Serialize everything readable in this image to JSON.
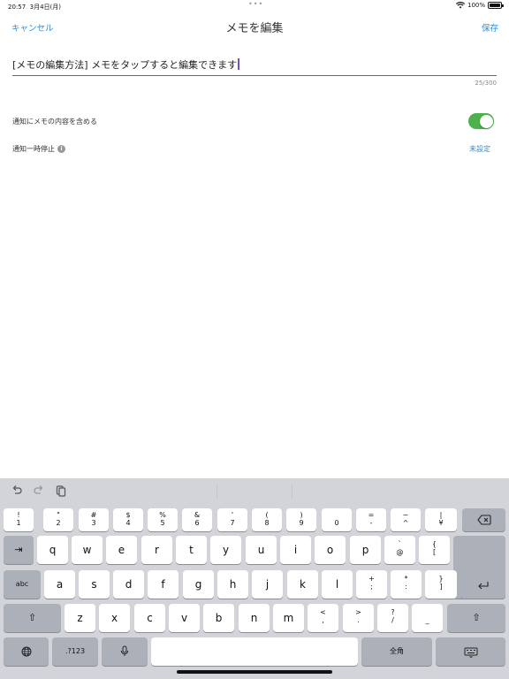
{
  "status_bar": {
    "time": "20:57",
    "date": "3月4日(月)",
    "battery": "100%"
  },
  "nav": {
    "cancel_label": "キャンセル",
    "title": "メモを編集",
    "save_label": "保存"
  },
  "memo": {
    "value": "[メモの編集方法] メモをタップすると編集できます",
    "counter": "25/300"
  },
  "settings": {
    "include_memo_label": "通知にメモの内容を含める",
    "include_memo_on": true,
    "pause_label": "通知一時停止",
    "pause_value": "未設定"
  },
  "colors": {
    "accent": "#2f8bd0",
    "toggle_on": "#4cb24c",
    "focus_line": "#6f53b8",
    "keyboard_bg": "#d2d4da"
  },
  "keyboard": {
    "toolbar_icons": [
      "undo-icon",
      "redo-icon",
      "clipboard-icon"
    ],
    "row1": [
      {
        "top": "!",
        "bot": "1"
      },
      {
        "top": "\"",
        "bot": "2"
      },
      {
        "top": "#",
        "bot": "3"
      },
      {
        "top": "$",
        "bot": "4"
      },
      {
        "top": "%",
        "bot": "5"
      },
      {
        "top": "&",
        "bot": "6"
      },
      {
        "top": "'",
        "bot": "7"
      },
      {
        "top": "(",
        "bot": "8"
      },
      {
        "top": ")",
        "bot": "9"
      },
      {
        "top": "",
        "bot": "0"
      },
      {
        "top": "=",
        "bot": "-"
      },
      {
        "top": "~",
        "bot": "^"
      },
      {
        "top": "|",
        "bot": "¥"
      }
    ],
    "row2": [
      "q",
      "w",
      "e",
      "r",
      "t",
      "y",
      "u",
      "i",
      "o",
      "p"
    ],
    "row2_extra": [
      {
        "top": "`",
        "bot": "@"
      },
      {
        "top": "{",
        "bot": "["
      }
    ],
    "row3_left": "abc",
    "row3": [
      "a",
      "s",
      "d",
      "f",
      "g",
      "h",
      "j",
      "k",
      "l"
    ],
    "row3_extra": [
      {
        "top": "+",
        "bot": ";"
      },
      {
        "top": "*",
        "bot": ":"
      },
      {
        "top": "}",
        "bot": "]"
      }
    ],
    "row4": [
      "z",
      "x",
      "c",
      "v",
      "b",
      "n",
      "m"
    ],
    "row4_extra": [
      {
        "top": "<",
        "bot": ","
      },
      {
        "top": ">",
        "bot": "."
      },
      {
        "top": "?",
        "bot": "/"
      },
      {
        "top": "",
        "bot": "_"
      }
    ],
    "numbers_label": ".?123",
    "fullwidth_label": "全角"
  }
}
